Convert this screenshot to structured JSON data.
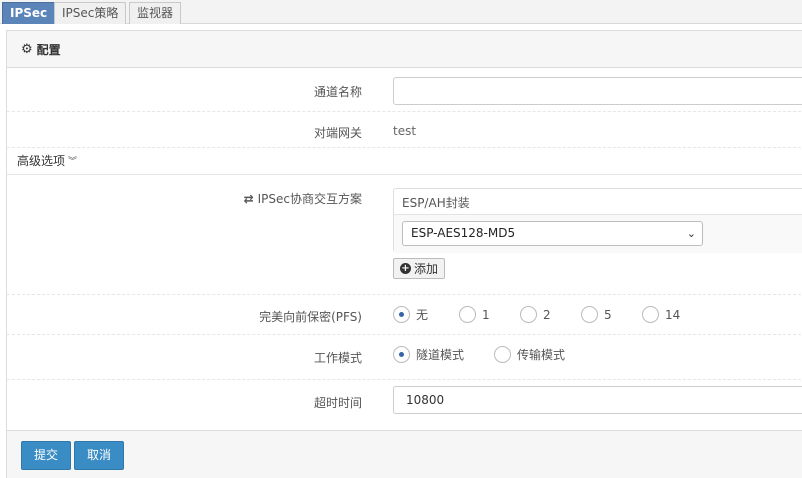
{
  "tabs": [
    {
      "label": "IPSec"
    },
    {
      "label": "IPSec策略"
    },
    {
      "label": "监视器"
    }
  ],
  "panel": {
    "title": "配置"
  },
  "form": {
    "tunnel_name": {
      "label": "通道名称",
      "value": ""
    },
    "peer_gateway": {
      "label": "对端网关",
      "value": "test"
    },
    "advanced": {
      "label": "高级选项"
    },
    "proposal": {
      "label": "IPSec协商交互方案",
      "box_title": "ESP/AH封装",
      "selected": "ESP-AES128-MD5",
      "add_label": "添加"
    },
    "pfs": {
      "label": "完美向前保密(PFS)",
      "options": [
        "无",
        "1",
        "2",
        "5",
        "14"
      ],
      "selected": "无"
    },
    "mode": {
      "label": "工作模式",
      "options": [
        "隧道模式",
        "传输模式"
      ],
      "selected": "隧道模式"
    },
    "timeout": {
      "label": "超时时间",
      "value": "10800"
    }
  },
  "buttons": {
    "submit": "提交",
    "cancel": "取消"
  },
  "colors": {
    "accent": "#3a8cc4",
    "active_tab": "#5b84b8",
    "radio_dot": "#3465a4"
  },
  "icons": {
    "panel": "gear-icon",
    "proposal": "exchange-icon",
    "advanced": "double-chevron-down-icon",
    "add": "plus-circle-icon",
    "select": "chevron-down-icon"
  }
}
